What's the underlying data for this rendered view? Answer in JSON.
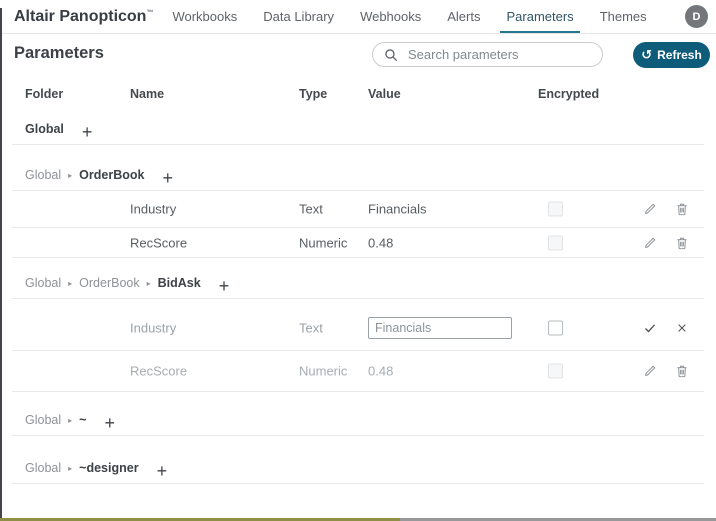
{
  "colors": {
    "accent": "#26798c",
    "refresh_bg": "#0d5c7a"
  },
  "header": {
    "logo": "Altair Panopticon",
    "trademark": "™",
    "nav": [
      "Workbooks",
      "Data Library",
      "Webhooks",
      "Alerts",
      "Parameters",
      "Themes"
    ],
    "active_tab": "Parameters",
    "avatar_initial": "D"
  },
  "toolbar": {
    "title": "Parameters",
    "search_placeholder": "Search parameters",
    "refresh_label": "Refresh",
    "refresh_glyph": "↺"
  },
  "table": {
    "columns": {
      "folder": "Folder",
      "name": "Name",
      "type": "Type",
      "value": "Value",
      "encrypted": "Encrypted"
    },
    "add_label": "+",
    "crumb_separator": "▸",
    "groups": [
      {
        "crumbs": [
          {
            "label": "Global"
          }
        ],
        "rows": []
      },
      {
        "crumbs": [
          {
            "label": "Global"
          },
          {
            "label": "OrderBook"
          }
        ],
        "rows": [
          {
            "name": "Industry",
            "type": "Text",
            "value": "Financials",
            "encrypted": false,
            "state": "normal"
          },
          {
            "name": "RecScore",
            "type": "Numeric",
            "value": "0.48",
            "encrypted": false,
            "state": "normal"
          }
        ]
      },
      {
        "crumbs": [
          {
            "label": "Global"
          },
          {
            "label": "OrderBook"
          },
          {
            "label": "BidAsk"
          }
        ],
        "rows": [
          {
            "name": "Industry",
            "type": "Text",
            "value": "Financials",
            "encrypted": false,
            "state": "editing"
          },
          {
            "name": "RecScore",
            "type": "Numeric",
            "value": "0.48",
            "encrypted": false,
            "state": "muted"
          }
        ]
      },
      {
        "crumbs": [
          {
            "label": "Global"
          },
          {
            "label": "~"
          }
        ],
        "rows": []
      },
      {
        "crumbs": [
          {
            "label": "Global"
          },
          {
            "label": "~designer"
          }
        ],
        "rows": []
      }
    ]
  },
  "icons": {
    "search": "magnifier-icon",
    "refresh": "refresh-arrow-icon",
    "edit": "pencil-icon",
    "delete": "trash-icon",
    "confirm": "check-icon",
    "cancel": "x-icon",
    "add": "plus-icon",
    "breadcrumb": "chevron-right-icon"
  }
}
